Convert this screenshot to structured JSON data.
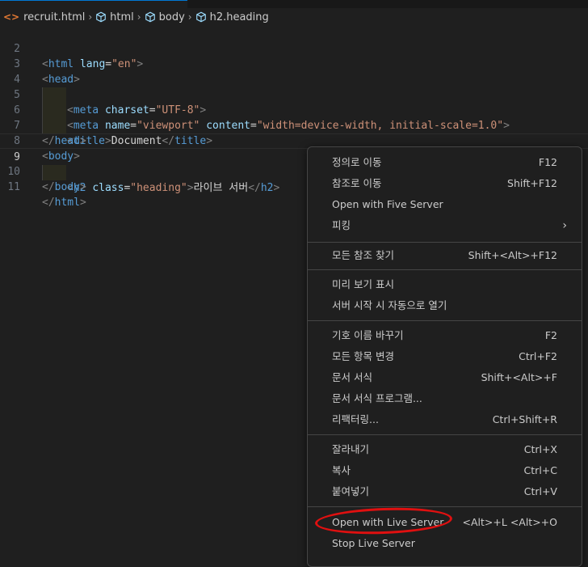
{
  "breadcrumb": {
    "file": "recruit.html",
    "items": [
      "html",
      "body",
      "h2.heading"
    ]
  },
  "editor": {
    "active_line": "9",
    "line_numbers": [
      "2",
      "3",
      "4",
      "5",
      "6",
      "7",
      "8",
      "9",
      "10",
      "11"
    ],
    "lines": {
      "l2": [
        {
          "c": "t",
          "v": "<"
        },
        {
          "c": "tn",
          "v": "html"
        },
        {
          "c": "tx",
          "v": " "
        },
        {
          "c": "an",
          "v": "lang"
        },
        {
          "c": "tx",
          "v": "="
        },
        {
          "c": "av",
          "v": "\"en\""
        },
        {
          "c": "t",
          "v": ">"
        }
      ],
      "l3": [
        {
          "c": "t",
          "v": "<"
        },
        {
          "c": "tn",
          "v": "head"
        },
        {
          "c": "t",
          "v": ">"
        }
      ],
      "l4": [
        {
          "c": "t",
          "v": "<"
        },
        {
          "c": "tn",
          "v": "meta"
        },
        {
          "c": "tx",
          "v": " "
        },
        {
          "c": "an",
          "v": "charset"
        },
        {
          "c": "tx",
          "v": "="
        },
        {
          "c": "av",
          "v": "\"UTF-8\""
        },
        {
          "c": "t",
          "v": ">"
        }
      ],
      "l5": [
        {
          "c": "t",
          "v": "<"
        },
        {
          "c": "tn",
          "v": "meta"
        },
        {
          "c": "tx",
          "v": " "
        },
        {
          "c": "an",
          "v": "name"
        },
        {
          "c": "tx",
          "v": "="
        },
        {
          "c": "av",
          "v": "\"viewport\""
        },
        {
          "c": "tx",
          "v": " "
        },
        {
          "c": "an",
          "v": "content"
        },
        {
          "c": "tx",
          "v": "="
        },
        {
          "c": "av",
          "v": "\"width=device-width, initial-scale=1.0\""
        },
        {
          "c": "t",
          "v": ">"
        }
      ],
      "l6": [
        {
          "c": "t",
          "v": "<"
        },
        {
          "c": "tn",
          "v": "title"
        },
        {
          "c": "t",
          "v": ">"
        },
        {
          "c": "tx",
          "v": "Document"
        },
        {
          "c": "t",
          "v": "</"
        },
        {
          "c": "tn",
          "v": "title"
        },
        {
          "c": "t",
          "v": ">"
        }
      ],
      "l7": [
        {
          "c": "t",
          "v": "</"
        },
        {
          "c": "tn",
          "v": "head"
        },
        {
          "c": "t",
          "v": ">"
        }
      ],
      "l8": [
        {
          "c": "t",
          "v": "<"
        },
        {
          "c": "tn",
          "v": "body"
        },
        {
          "c": "t",
          "v": ">"
        }
      ],
      "l9": [
        {
          "c": "t",
          "v": "<"
        },
        {
          "c": "tn",
          "v": "h2"
        },
        {
          "c": "tx",
          "v": " "
        },
        {
          "c": "an",
          "v": "class"
        },
        {
          "c": "tx",
          "v": "="
        },
        {
          "c": "av",
          "v": "\"heading\""
        },
        {
          "c": "t",
          "v": ">"
        },
        {
          "c": "tx",
          "v": "라이브 서버"
        },
        {
          "c": "t",
          "v": "</"
        },
        {
          "c": "tn",
          "v": "h2"
        },
        {
          "c": "t",
          "v": ">"
        }
      ],
      "l10": [
        {
          "c": "t",
          "v": "</"
        },
        {
          "c": "tn",
          "v": "body"
        },
        {
          "c": "t",
          "v": ">"
        }
      ],
      "l11": [
        {
          "c": "t",
          "v": "</"
        },
        {
          "c": "tn",
          "v": "html"
        },
        {
          "c": "t",
          "v": ">"
        }
      ]
    }
  },
  "context_menu": {
    "items": [
      {
        "label": "정의로 이동",
        "shortcut": "F12"
      },
      {
        "label": "참조로 이동",
        "shortcut": "Shift+F12"
      },
      {
        "label": "Open with Five Server",
        "shortcut": ""
      },
      {
        "label": "피킹",
        "shortcut": ""
      },
      {
        "label": "모든 참조 찾기",
        "shortcut": "Shift+<Alt>+F12"
      },
      {
        "label": "미리 보기 표시",
        "shortcut": ""
      },
      {
        "label": "서버 시작 시 자동으로 열기",
        "shortcut": ""
      },
      {
        "label": "기호 이름 바꾸기",
        "shortcut": "F2"
      },
      {
        "label": "모든 항목 변경",
        "shortcut": "Ctrl+F2"
      },
      {
        "label": "문서 서식",
        "shortcut": "Shift+<Alt>+F"
      },
      {
        "label": "문서 서식 프로그램...",
        "shortcut": ""
      },
      {
        "label": "리팩터링...",
        "shortcut": "Ctrl+Shift+R"
      },
      {
        "label": "잘라내기",
        "shortcut": "Ctrl+X"
      },
      {
        "label": "복사",
        "shortcut": "Ctrl+C"
      },
      {
        "label": "붙여넣기",
        "shortcut": "Ctrl+V"
      },
      {
        "label": "Open with Live Server",
        "shortcut": "<Alt>+L <Alt>+O"
      },
      {
        "label": "Stop Live Server",
        "shortcut": ""
      }
    ]
  },
  "colors": {
    "background": "#1f1f1f",
    "tag_name": "#569cd6",
    "attr_name": "#9cdcfe",
    "attr_value": "#ce9178",
    "annotation": "#e01010"
  }
}
